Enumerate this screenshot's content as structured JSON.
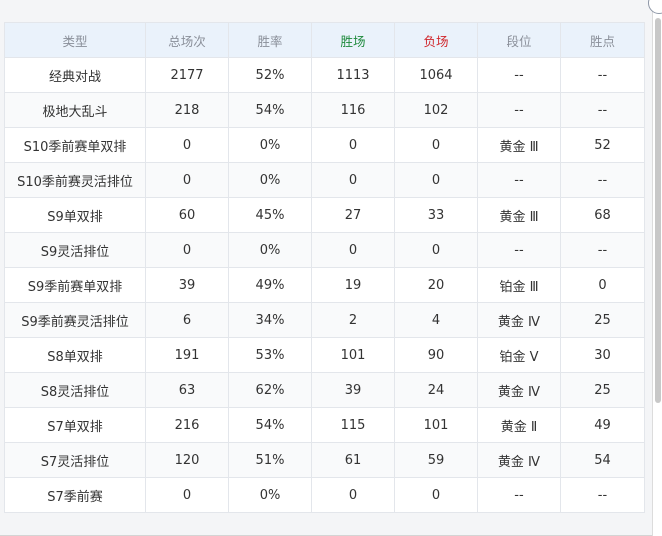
{
  "headers": {
    "type": "类型",
    "total": "总场次",
    "rate": "胜率",
    "wins": "胜场",
    "losses": "负场",
    "tier": "段位",
    "points": "胜点"
  },
  "colors": {
    "wins_header": "#1e8a3c",
    "losses_header": "#d0262b",
    "header_bg": "#eaf2fb"
  },
  "rows": [
    {
      "type": "经典对战",
      "total": "2177",
      "rate": "52%",
      "wins": "1113",
      "losses": "1064",
      "tier": "--",
      "points": "--"
    },
    {
      "type": "极地大乱斗",
      "total": "218",
      "rate": "54%",
      "wins": "116",
      "losses": "102",
      "tier": "--",
      "points": "--"
    },
    {
      "type": "S10季前赛单双排",
      "total": "0",
      "rate": "0%",
      "wins": "0",
      "losses": "0",
      "tier": "黄金 Ⅲ",
      "points": "52"
    },
    {
      "type": "S10季前赛灵活排位",
      "total": "0",
      "rate": "0%",
      "wins": "0",
      "losses": "0",
      "tier": "--",
      "points": "--"
    },
    {
      "type": "S9单双排",
      "total": "60",
      "rate": "45%",
      "wins": "27",
      "losses": "33",
      "tier": "黄金 Ⅲ",
      "points": "68"
    },
    {
      "type": "S9灵活排位",
      "total": "0",
      "rate": "0%",
      "wins": "0",
      "losses": "0",
      "tier": "--",
      "points": "--"
    },
    {
      "type": "S9季前赛单双排",
      "total": "39",
      "rate": "49%",
      "wins": "19",
      "losses": "20",
      "tier": "铂金 Ⅲ",
      "points": "0"
    },
    {
      "type": "S9季前赛灵活排位",
      "total": "6",
      "rate": "34%",
      "wins": "2",
      "losses": "4",
      "tier": "黄金 Ⅳ",
      "points": "25"
    },
    {
      "type": "S8单双排",
      "total": "191",
      "rate": "53%",
      "wins": "101",
      "losses": "90",
      "tier": "铂金 Ⅴ",
      "points": "30"
    },
    {
      "type": "S8灵活排位",
      "total": "63",
      "rate": "62%",
      "wins": "39",
      "losses": "24",
      "tier": "黄金 Ⅳ",
      "points": "25"
    },
    {
      "type": "S7单双排",
      "total": "216",
      "rate": "54%",
      "wins": "115",
      "losses": "101",
      "tier": "黄金 Ⅱ",
      "points": "49"
    },
    {
      "type": "S7灵活排位",
      "total": "120",
      "rate": "51%",
      "wins": "61",
      "losses": "59",
      "tier": "黄金 Ⅳ",
      "points": "54"
    },
    {
      "type": "S7季前赛",
      "total": "0",
      "rate": "0%",
      "wins": "0",
      "losses": "0",
      "tier": "--",
      "points": "--"
    }
  ]
}
